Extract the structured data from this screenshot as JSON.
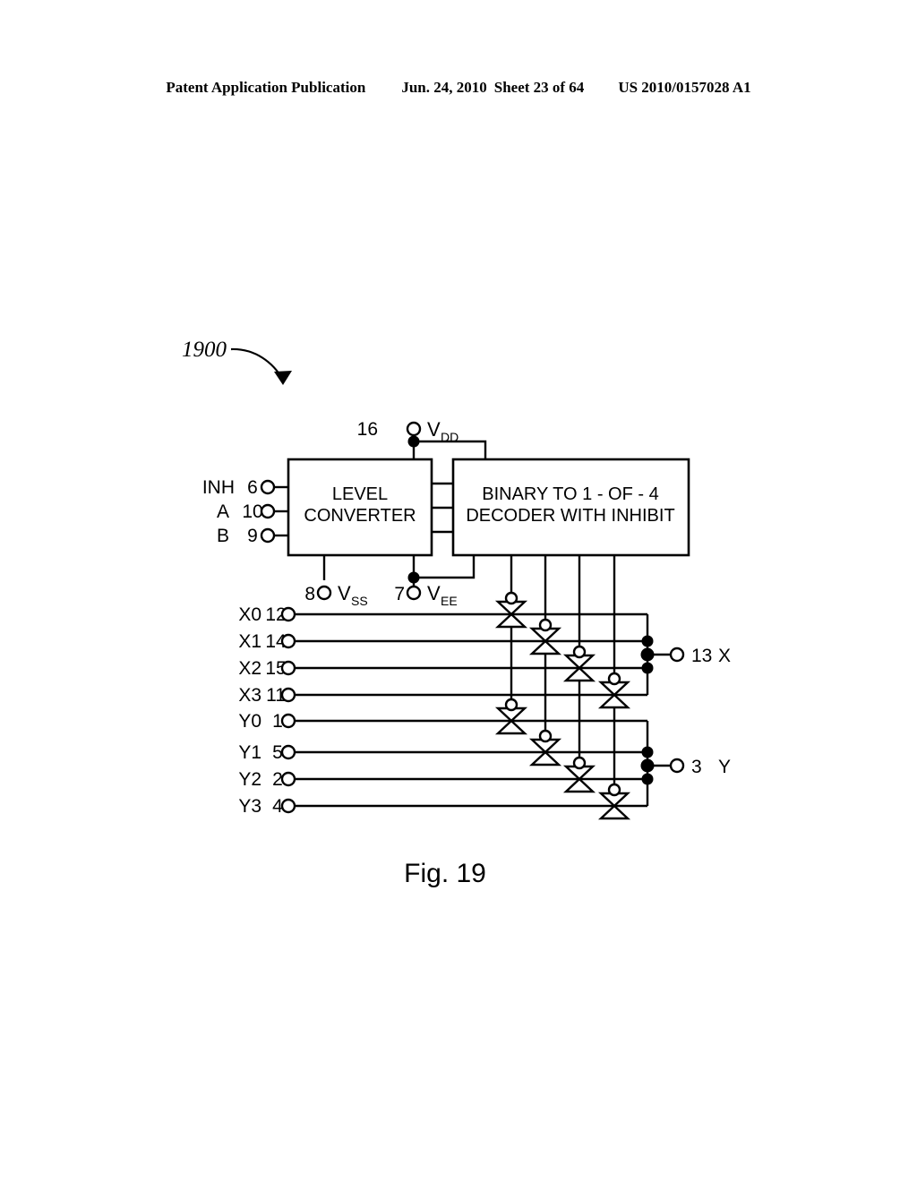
{
  "header": {
    "publication": "Patent Application Publication",
    "date": "Jun. 24, 2010",
    "sheet": "Sheet 23 of 64",
    "number": "US 2010/0157028 A1"
  },
  "figure": {
    "reference_numeral": "1900",
    "caption": "Fig. 19"
  },
  "blocks": {
    "level_converter": {
      "line1": "LEVEL",
      "line2": "CONVERTER"
    },
    "decoder": {
      "line1": "BINARY TO 1 - OF - 4",
      "line2": "DECODER WITH INHIBIT"
    }
  },
  "power_pins": [
    {
      "pin": "16",
      "name": "V",
      "subscript": "DD"
    },
    {
      "pin": "8",
      "name": "V",
      "subscript": "SS"
    },
    {
      "pin": "7",
      "name": "V",
      "subscript": "EE"
    }
  ],
  "control_inputs": [
    {
      "signal": "INH",
      "pin": "6"
    },
    {
      "signal": "A",
      "pin": "10"
    },
    {
      "signal": "B",
      "pin": "9"
    }
  ],
  "switch_inputs": [
    {
      "signal": "X0",
      "pin": "12"
    },
    {
      "signal": "X1",
      "pin": "14"
    },
    {
      "signal": "X2",
      "pin": "15"
    },
    {
      "signal": "X3",
      "pin": "11"
    },
    {
      "signal": "Y0",
      "pin": "1"
    },
    {
      "signal": "Y1",
      "pin": "5"
    },
    {
      "signal": "Y2",
      "pin": "2"
    },
    {
      "signal": "Y3",
      "pin": "4"
    }
  ],
  "outputs": [
    {
      "pin": "13",
      "signal": "X"
    },
    {
      "pin": "3",
      "signal": "Y"
    }
  ],
  "colors": {
    "ink": "#000000",
    "paper": "#ffffff"
  },
  "chart_data": {
    "type": "diagram",
    "title": "Fig. 19",
    "description": "Schematic block diagram 1900 of a dual 4-channel analog multiplexer/demultiplexer",
    "nodes": [
      {
        "id": "level-converter",
        "label": "LEVEL CONVERTER"
      },
      {
        "id": "decoder",
        "label": "BINARY TO 1 - OF - 4 DECODER WITH INHIBIT"
      }
    ],
    "transmission_gates": 8
  }
}
